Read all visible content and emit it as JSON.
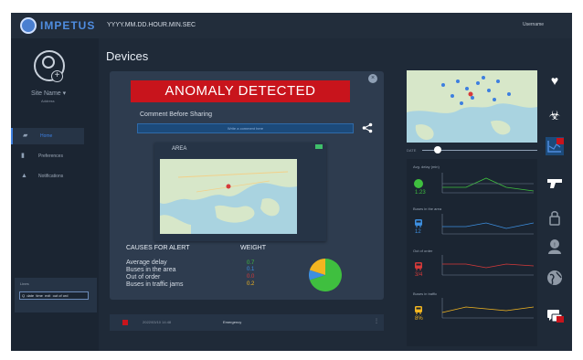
{
  "header": {
    "brand": "IMPETUS",
    "datetime": "YYYY.MM.DD.HOUR.MIN.SEC",
    "username": "Username"
  },
  "sidebar": {
    "site_name": "Site Name",
    "site_address": "Address",
    "items": [
      {
        "label": "Home",
        "icon": "home-icon"
      },
      {
        "label": "Preferences",
        "icon": "chart-icon"
      },
      {
        "label": "Notifications",
        "icon": "bell-icon"
      }
    ],
    "filter": {
      "title": "Lines",
      "value": "Q  date  time  exit  out of ord"
    }
  },
  "main": {
    "title": "Devices",
    "alert": "ANOMALY DETECTED",
    "comment_label": "Comment Before Sharing",
    "comment_placeholder": "Write a comment here",
    "area_label": "AREA",
    "causes_title": "CAUSES FOR ALERT",
    "weight_title": "WEIGHT",
    "causes": [
      {
        "label": "Average delay",
        "weight": "0.7",
        "color": "#3fbf3f"
      },
      {
        "label": "Buses in the area",
        "weight": "0.1",
        "color": "#3d8fe0"
      },
      {
        "label": "Out of order",
        "weight": "0.0",
        "color": "#d63a3a"
      },
      {
        "label": "Buses in traffic jams",
        "weight": "0.2",
        "color": "#f2b520"
      }
    ],
    "event": {
      "time": "2022/03/10 14:48",
      "type": "Emergency"
    }
  },
  "right": {
    "date_label": "DATE",
    "stats": [
      {
        "label": "Avg. delay (min)",
        "value": "1.23",
        "color": "#3fbf3f",
        "icon": "status-dot-icon"
      },
      {
        "label": "Buses in the area",
        "value": "12",
        "color": "#3d8fe0",
        "icon": "bus-icon"
      },
      {
        "label": "Out of order",
        "value": "3/4",
        "color": "#d63a3a",
        "icon": "bus-icon"
      },
      {
        "label": "Buses in traffic",
        "value": "8%",
        "color": "#f2b520",
        "icon": "bus-icon"
      }
    ],
    "side_icons": [
      "heartbeat-icon",
      "biohazard-icon",
      "graph-icon",
      "gun-icon",
      "lock-icon",
      "user-warning-icon",
      "globe-icon",
      "chat-icon"
    ]
  }
}
